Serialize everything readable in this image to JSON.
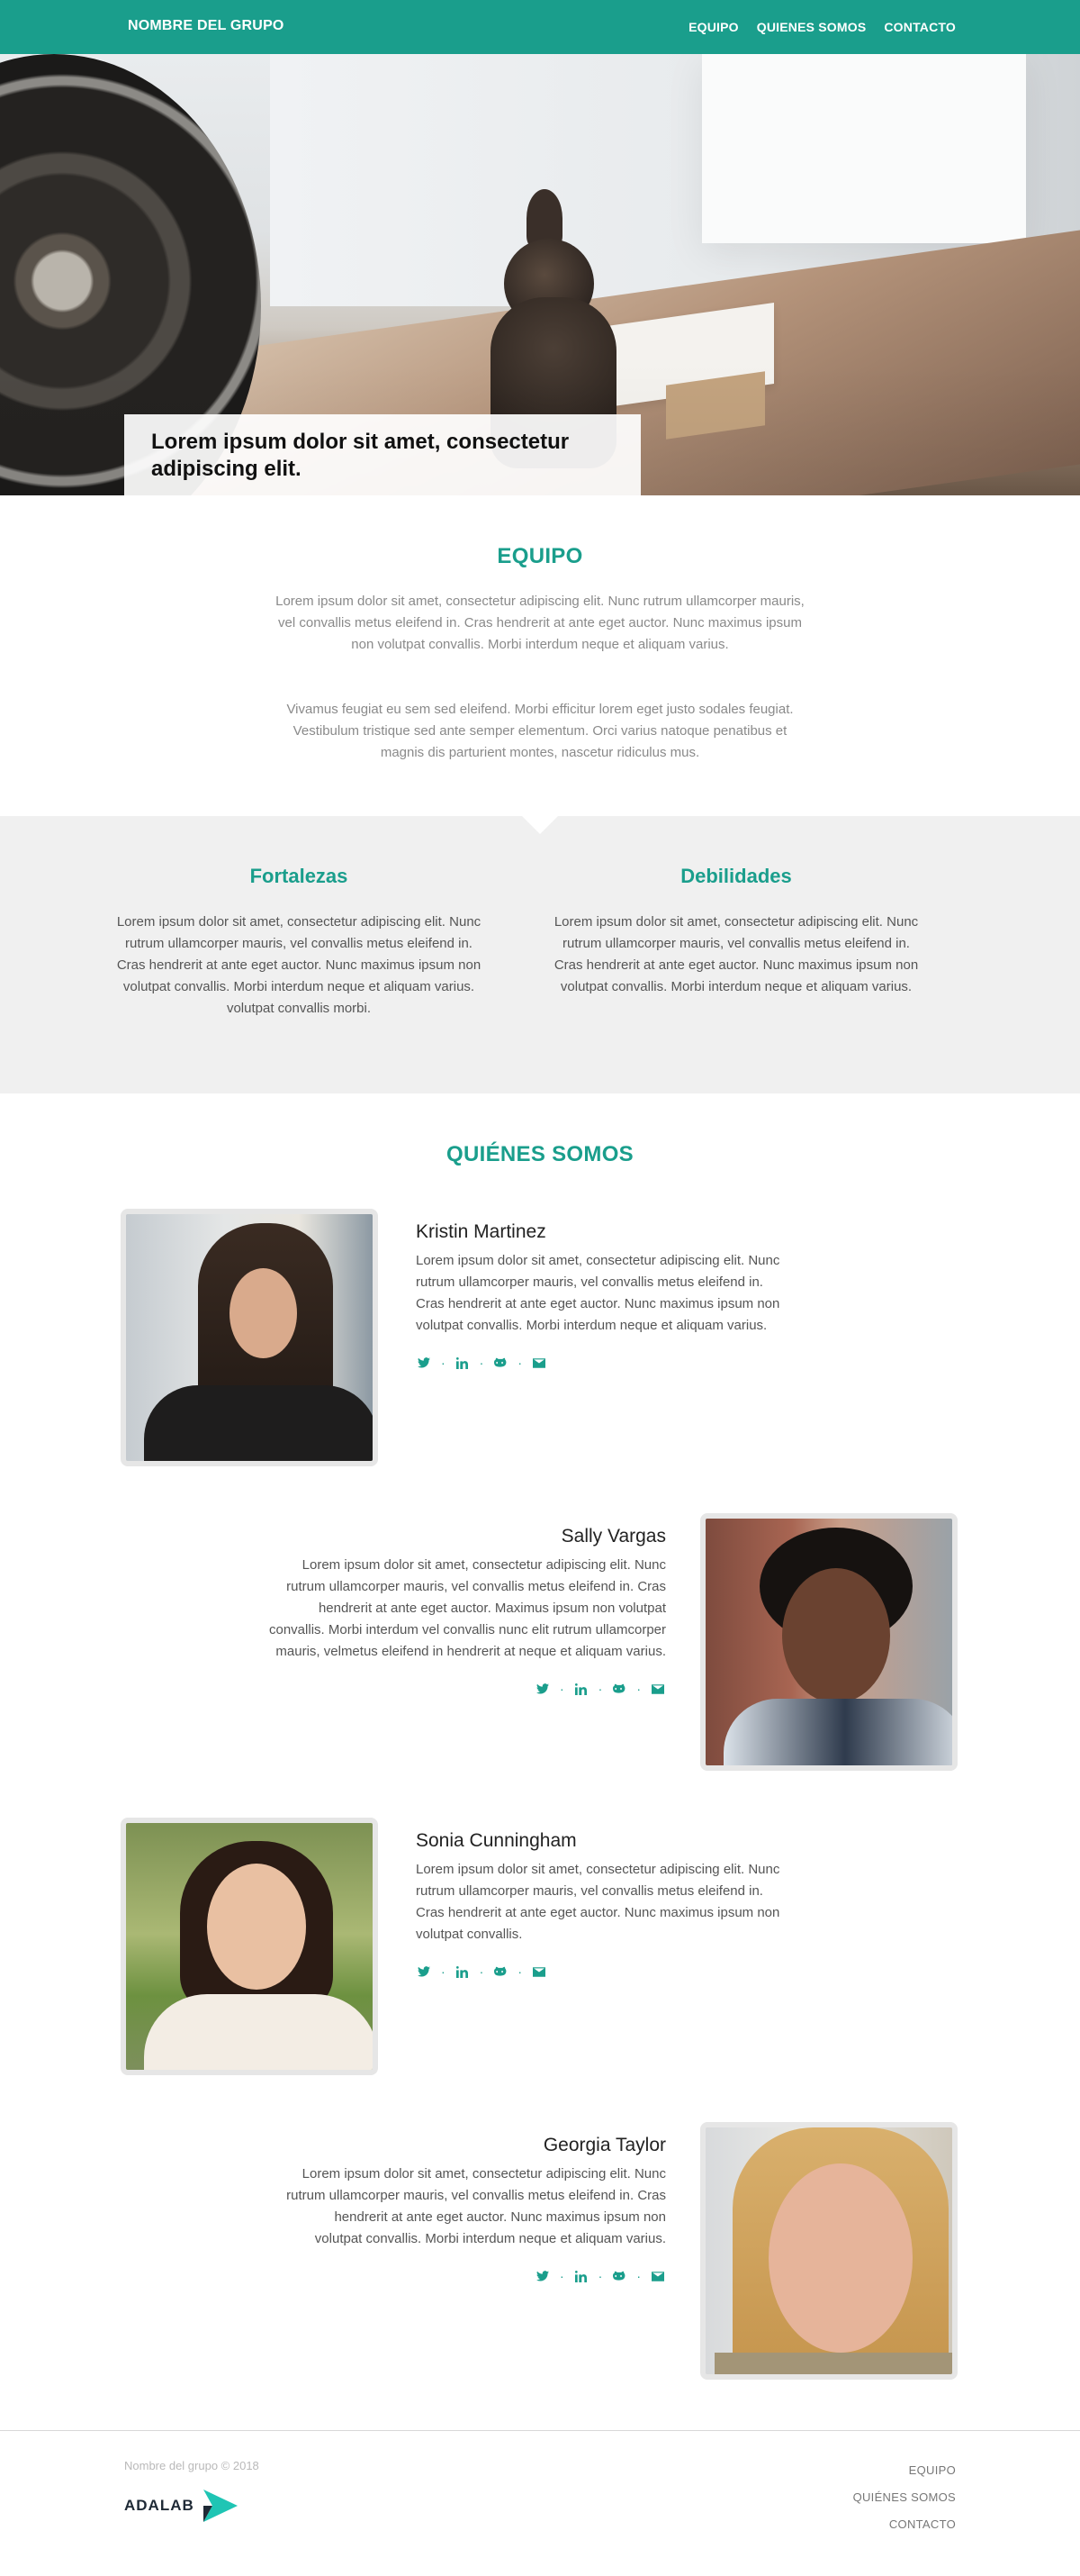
{
  "header": {
    "brand": "NOMBRE DEL GRUPO",
    "nav": [
      "EQUIPO",
      "QUIENES SOMOS",
      "CONTACTO"
    ]
  },
  "hero": {
    "caption": "Lorem ipsum dolor sit amet, consectetur adipiscing elit."
  },
  "equipo": {
    "title": "EQUIPO",
    "paragraph1": "Lorem ipsum dolor sit amet, consectetur adipiscing elit. Nunc rutrum ullamcorper mauris, vel convallis metus eleifend in. Cras hendrerit at ante eget auctor. Nunc maximus ipsum non volutpat convallis. Morbi interdum neque et aliquam varius.",
    "paragraph2": "Vivamus feugiat eu sem sed eleifend. Morbi efficitur lorem eget justo sodales feugiat. Vestibulum tristique sed ante semper elementum. Orci varius natoque penatibus et magnis dis parturient montes, nascetur ridiculus mus."
  },
  "features": {
    "strengths": {
      "title": "Fortalezas",
      "text": "Lorem ipsum dolor sit amet, consectetur adipiscing elit. Nunc rutrum ullamcorper mauris, vel convallis metus eleifend in. Cras hendrerit at ante eget auctor. Nunc maximus ipsum non volutpat convallis. Morbi interdum neque et aliquam varius.",
      "text_extra": "volutpat convallis morbi."
    },
    "weaknesses": {
      "title": "Debilidades",
      "text": "Lorem ipsum dolor sit amet, consectetur adipiscing elit. Nunc rutrum ullamcorper mauris, vel convallis metus eleifend in. Cras hendrerit at ante eget auctor. Nunc maximus ipsum non volutpat convallis. Morbi interdum neque et aliquam varius."
    }
  },
  "about": {
    "title": "QUIÉNES SOMOS",
    "members": [
      {
        "name": "Kristin Martinez",
        "bio": "Lorem ipsum dolor sit amet, consectetur adipiscing elit. Nunc rutrum ullamcorper mauris, vel convallis metus eleifend in. Cras hendrerit at ante eget auctor. Nunc maximus ipsum non volutpat convallis. Morbi interdum neque et aliquam varius."
      },
      {
        "name": "Sally Vargas",
        "bio": "Lorem ipsum dolor sit amet, consectetur adipiscing elit. Nunc rutrum ullamcorper mauris, vel convallis metus eleifend in. Cras hendrerit at ante eget auctor. Maximus ipsum non volutpat convallis. Morbi interdum vel convallis nunc elit rutrum ullamcorper mauris, velmetus eleifend in hendrerit at neque et aliquam varius."
      },
      {
        "name": "Sonia Cunningham",
        "bio": "Lorem ipsum dolor sit amet, consectetur adipiscing elit. Nunc rutrum ullamcorper mauris, vel convallis metus eleifend in. Cras hendrerit at ante eget auctor. Nunc maximus ipsum non volutpat convallis."
      },
      {
        "name": "Georgia Taylor",
        "bio": "Lorem ipsum dolor sit amet, consectetur adipiscing elit. Nunc rutrum ullamcorper mauris, vel convallis metus eleifend in. Cras hendrerit at ante eget auctor. Nunc maximus ipsum non volutpat convallis. Morbi interdum neque et aliquam varius."
      }
    ],
    "social_icons": [
      "twitter-icon",
      "linkedin-icon",
      "github-icon",
      "mail-icon"
    ],
    "separator": "·"
  },
  "footer": {
    "copyright": "Nombre del grupo © 2018",
    "logo_text": "ADALAB",
    "nav": [
      "EQUIPO",
      "QUIÉNES SOMOS",
      "CONTACTO"
    ]
  },
  "colors": {
    "accent": "#1a9e8c",
    "band": "#f0f0f0"
  }
}
